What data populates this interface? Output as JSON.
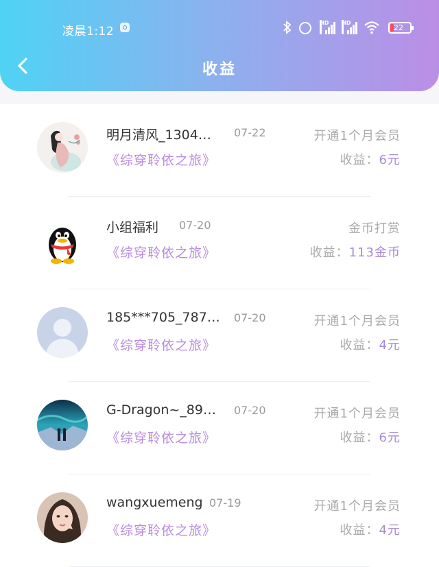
{
  "status_bar": {
    "time": "凌晨1:12",
    "signal_1_label": "HD",
    "signal_2_label": "HD",
    "battery": "22",
    "icons": [
      "notification-icon",
      "bluetooth-icon",
      "alarm-icon",
      "signal-icon",
      "signal-icon",
      "wifi-icon",
      "battery-icon"
    ]
  },
  "header": {
    "title": "收益",
    "back_icon": "chevron-left-icon"
  },
  "colors": {
    "gradient_start": "#4fd3f5",
    "gradient_end": "#bb8ee6",
    "accent": "#b98be0"
  },
  "items": [
    {
      "name": "明月清风_1304…",
      "date": "07-22",
      "book": "《综穿聆依之旅》",
      "type": "开通1个月会员",
      "earn_label": "收益：",
      "earn_value": "6元",
      "avatar": "woman-painting"
    },
    {
      "name": "小组福利",
      "date": "07-20",
      "book": "《综穿聆依之旅》",
      "type": "金币打赏",
      "earn_label": "收益：",
      "earn_value": "113金币",
      "avatar": "qq-penguin"
    },
    {
      "name": "185***705_7877…",
      "date": "07-20",
      "book": "《综穿聆依之旅》",
      "type": "开通1个月会员",
      "earn_label": "收益：",
      "earn_value": "4元",
      "avatar": "default-user"
    },
    {
      "name": "G-Dragon~_89…",
      "date": "07-20",
      "book": "《综穿聆依之旅》",
      "type": "开通1个月会员",
      "earn_label": "收益：",
      "earn_value": "6元",
      "avatar": "aurora-scene"
    },
    {
      "name": "wangxuemeng",
      "date": "07-19",
      "book": "《综穿聆依之旅》",
      "type": "开通1个月会员",
      "earn_label": "收益：",
      "earn_value": "4元",
      "avatar": "girl-photo"
    }
  ]
}
